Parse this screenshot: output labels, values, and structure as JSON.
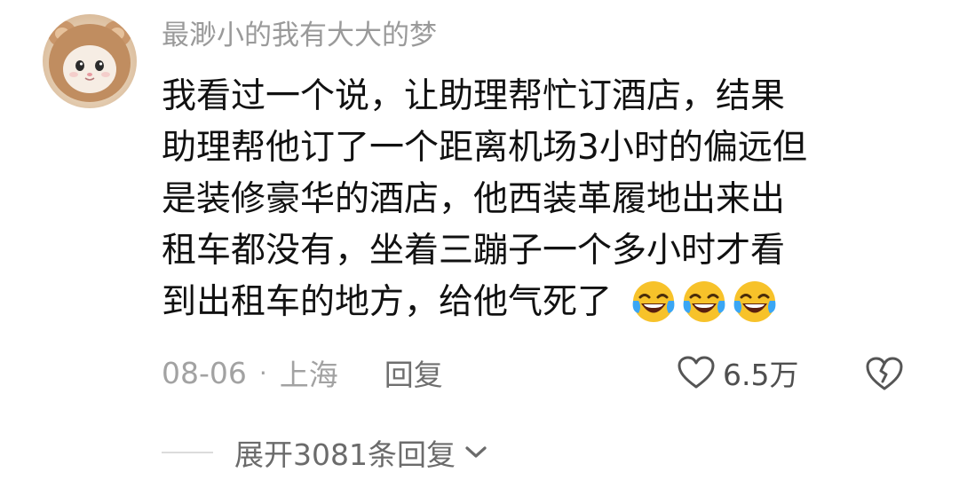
{
  "comment": {
    "username": "最渺小的我有大大的梦",
    "text_lines": [
      "我看过一个说，让助理帮忙订酒店，结果",
      "助理帮他订了一个距离机场3小时的偏远但",
      "是装修豪华的酒店，他西装革履地出来出",
      "租车都没有，坐着三蹦子一个多小时才看",
      "到出租车的地方，给他气死了"
    ],
    "emoji": [
      "laughing-crying-face-emoji",
      "laughing-crying-face-emoji",
      "laughing-crying-face-emoji"
    ],
    "date": "08-06",
    "separator": "·",
    "location": "上海",
    "reply_label": "回复",
    "like_count": "6.5万",
    "expand_replies_label": "展开3081条回复"
  },
  "colors": {
    "username": "#9a9a9a",
    "text": "#111111",
    "meta": "#a2a2a2",
    "emoji_face": "#f7c22a",
    "emoji_tears": "#3aa6f4"
  },
  "icons": {
    "like": "heart-outline-icon",
    "dislike": "broken-heart-icon",
    "expand": "chevron-down-icon"
  }
}
